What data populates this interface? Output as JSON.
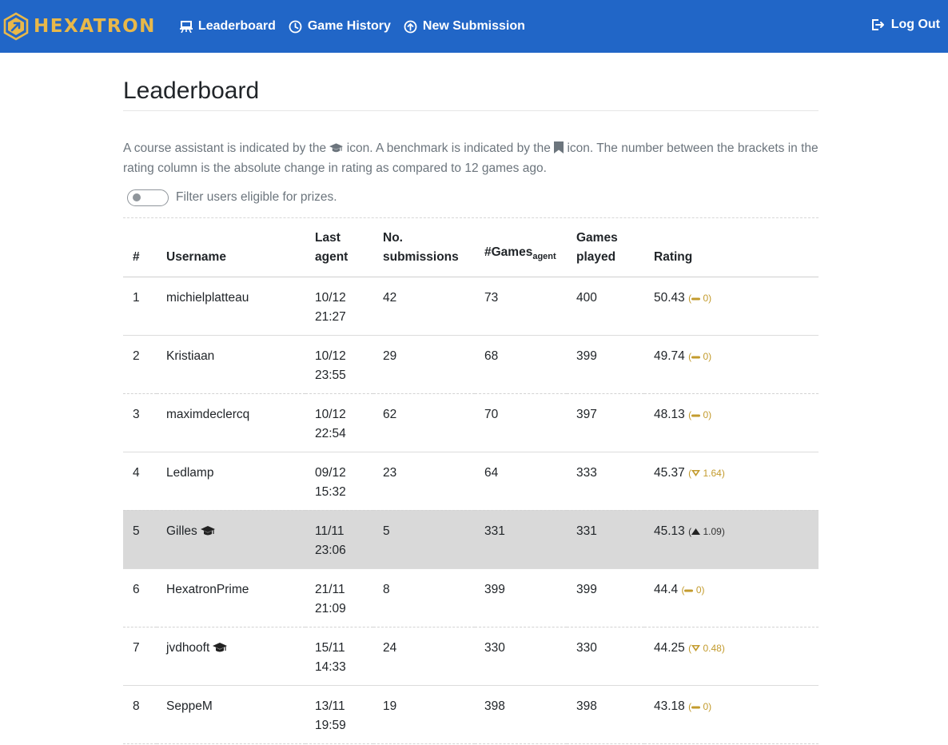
{
  "brand": {
    "name": "HEXATRON",
    "accent": "#e8b84a",
    "navbar_bg": "#2166c7"
  },
  "nav": {
    "items": [
      {
        "label": "Leaderboard",
        "icon": "easel-icon"
      },
      {
        "label": "Game History",
        "icon": "clock-icon"
      },
      {
        "label": "New Submission",
        "icon": "upload-circle-icon"
      }
    ],
    "logout_label": "Log Out"
  },
  "page": {
    "title": "Leaderboard",
    "desc_part1": "A course assistant is indicated by the ",
    "desc_part2": " icon. A benchmark is indicated by the ",
    "desc_part3": " icon. The number between the brackets in the rating column is the absolute change in rating as compared to 12 games ago.",
    "toggle_label": "Filter users eligible for prizes.",
    "toggle_on": false
  },
  "table": {
    "headers": {
      "rank": "#",
      "username": "Username",
      "last_agent_1": "Last",
      "last_agent_2": "agent",
      "submissions_1": "No.",
      "submissions_2": "submissions",
      "games_agent": "#Games",
      "games_agent_sub": "agent",
      "played_1": "Games",
      "played_2": "played",
      "rating": "Rating"
    },
    "rows": [
      {
        "rank": "1",
        "username": "michielplatteau",
        "ca": false,
        "date": "10/12",
        "time": "21:27",
        "subs": "42",
        "games_agent": "73",
        "played": "400",
        "rating": "50.43",
        "trend": "flat",
        "delta": "0"
      },
      {
        "rank": "2",
        "username": "Kristiaan",
        "ca": false,
        "date": "10/12",
        "time": "23:55",
        "subs": "29",
        "games_agent": "68",
        "played": "399",
        "rating": "49.74",
        "trend": "flat",
        "delta": "0"
      },
      {
        "rank": "3",
        "username": "maximdeclercq",
        "ca": false,
        "date": "10/12",
        "time": "22:54",
        "subs": "62",
        "games_agent": "70",
        "played": "397",
        "rating": "48.13",
        "trend": "flat",
        "delta": "0"
      },
      {
        "rank": "4",
        "username": "Ledlamp",
        "ca": false,
        "date": "09/12",
        "time": "15:32",
        "subs": "23",
        "games_agent": "64",
        "played": "333",
        "rating": "45.37",
        "trend": "down",
        "delta": "1.64"
      },
      {
        "rank": "5",
        "username": "Gilles",
        "ca": true,
        "date": "11/11",
        "time": "23:06",
        "subs": "5",
        "games_agent": "331",
        "played": "331",
        "rating": "45.13",
        "trend": "up",
        "delta": "1.09"
      },
      {
        "rank": "6",
        "username": "HexatronPrime",
        "ca": false,
        "date": "21/11",
        "time": "21:09",
        "subs": "8",
        "games_agent": "399",
        "played": "399",
        "rating": "44.4",
        "trend": "flat",
        "delta": "0"
      },
      {
        "rank": "7",
        "username": "jvdhooft",
        "ca": true,
        "date": "15/11",
        "time": "14:33",
        "subs": "24",
        "games_agent": "330",
        "played": "330",
        "rating": "44.25",
        "trend": "down",
        "delta": "0.48"
      },
      {
        "rank": "8",
        "username": "SeppeM",
        "ca": false,
        "date": "13/11",
        "time": "19:59",
        "subs": "19",
        "games_agent": "398",
        "played": "398",
        "rating": "43.18",
        "trend": "flat",
        "delta": "0"
      }
    ],
    "highlight_row": 5,
    "colors": {
      "highlight_bg": "#d9d9d9",
      "delta_gold": "#c39b2d"
    }
  }
}
